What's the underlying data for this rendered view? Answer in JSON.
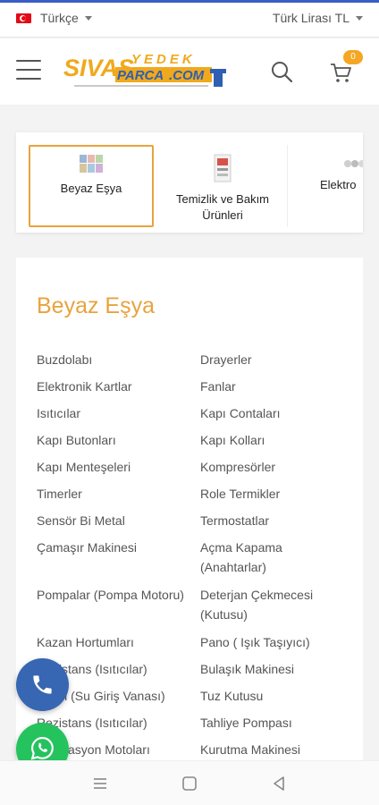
{
  "topbar": {
    "language": "Türkçe",
    "currency": "Türk Lirası TL"
  },
  "header": {
    "logo_text": "SIVAS YEDEK PARCA.COM",
    "cart_count": "0"
  },
  "categories": [
    {
      "label": "Beyaz Eşya",
      "active": true
    },
    {
      "label": "Temizlik ve Bakım Ürünleri",
      "active": false
    },
    {
      "label": "Elektro",
      "active": false
    }
  ],
  "section": {
    "title": "Beyaz Eşya",
    "left_items": [
      "Buzdolabı",
      "Elektronik Kartlar",
      "Isıtıcılar",
      "Kapı Butonları",
      "Kapı Menteşeleri",
      "Timerler",
      "Sensör Bi Metal",
      "Çamaşır Makinesi",
      "Pompalar (Pompa Motoru)",
      "Kazan Hortumları",
      "Rezistans (Isıtıcılar)",
      "Ventil (Su Giriş Vanası)",
      "Rezistans (Isıtıcılar)",
      "Sirkülasyon Motoları"
    ],
    "right_items": [
      "Drayerler",
      "Fanlar",
      "Kapı Contaları",
      "Kapı Kolları",
      "Kompresörler",
      "Role Termikler",
      "Termostatlar",
      "Açma Kapama (Anahtarlar)",
      "Deterjan Çekmecesi (Kutusu)",
      "Pano ( Işık Taşıyıcı)",
      "Bulaşık Makinesi",
      "Tuz Kutusu",
      "Tahliye Pompası",
      "Kurutma Makinesi"
    ]
  },
  "colors": {
    "accent": "#e8a33d",
    "phone_button": "#3766b3",
    "whatsapp_button": "#25c35e"
  }
}
